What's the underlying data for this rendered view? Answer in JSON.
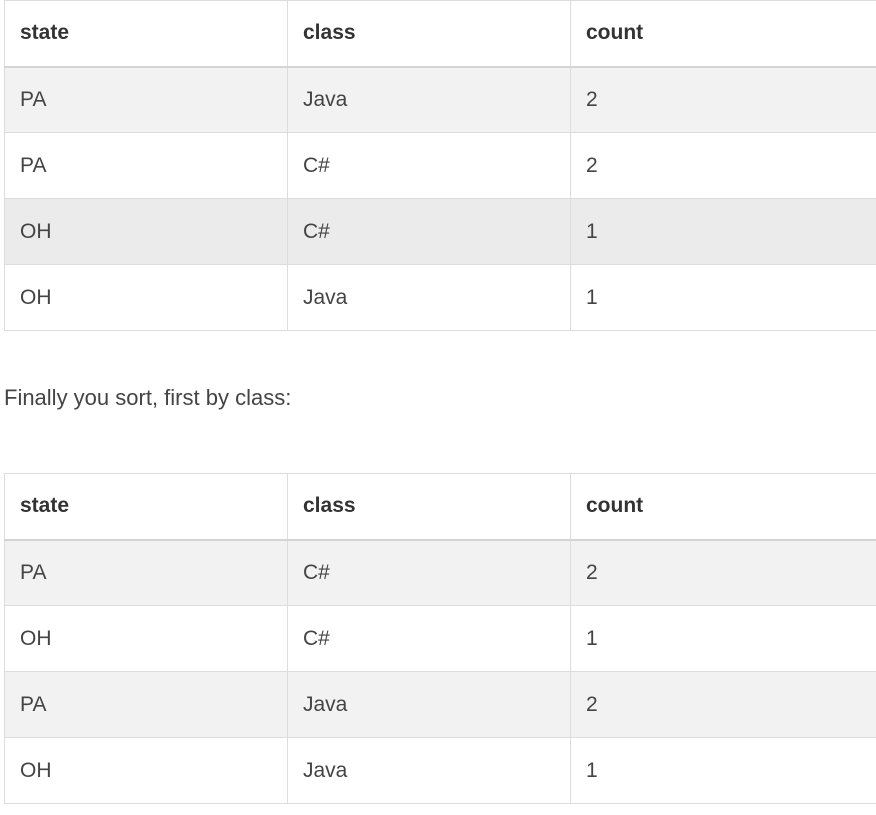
{
  "table1": {
    "headers": [
      "state",
      "class",
      "count"
    ],
    "rows": [
      [
        "PA",
        "Java",
        "2"
      ],
      [
        "PA",
        "C#",
        "2"
      ],
      [
        "OH",
        "C#",
        "1"
      ],
      [
        "OH",
        "Java",
        "1"
      ]
    ]
  },
  "paragraph": "Finally you sort, first by class:",
  "table2": {
    "headers": [
      "state",
      "class",
      "count"
    ],
    "rows": [
      [
        "PA",
        "C#",
        "2"
      ],
      [
        "OH",
        "C#",
        "1"
      ],
      [
        "PA",
        "Java",
        "2"
      ],
      [
        "OH",
        "Java",
        "1"
      ]
    ]
  }
}
